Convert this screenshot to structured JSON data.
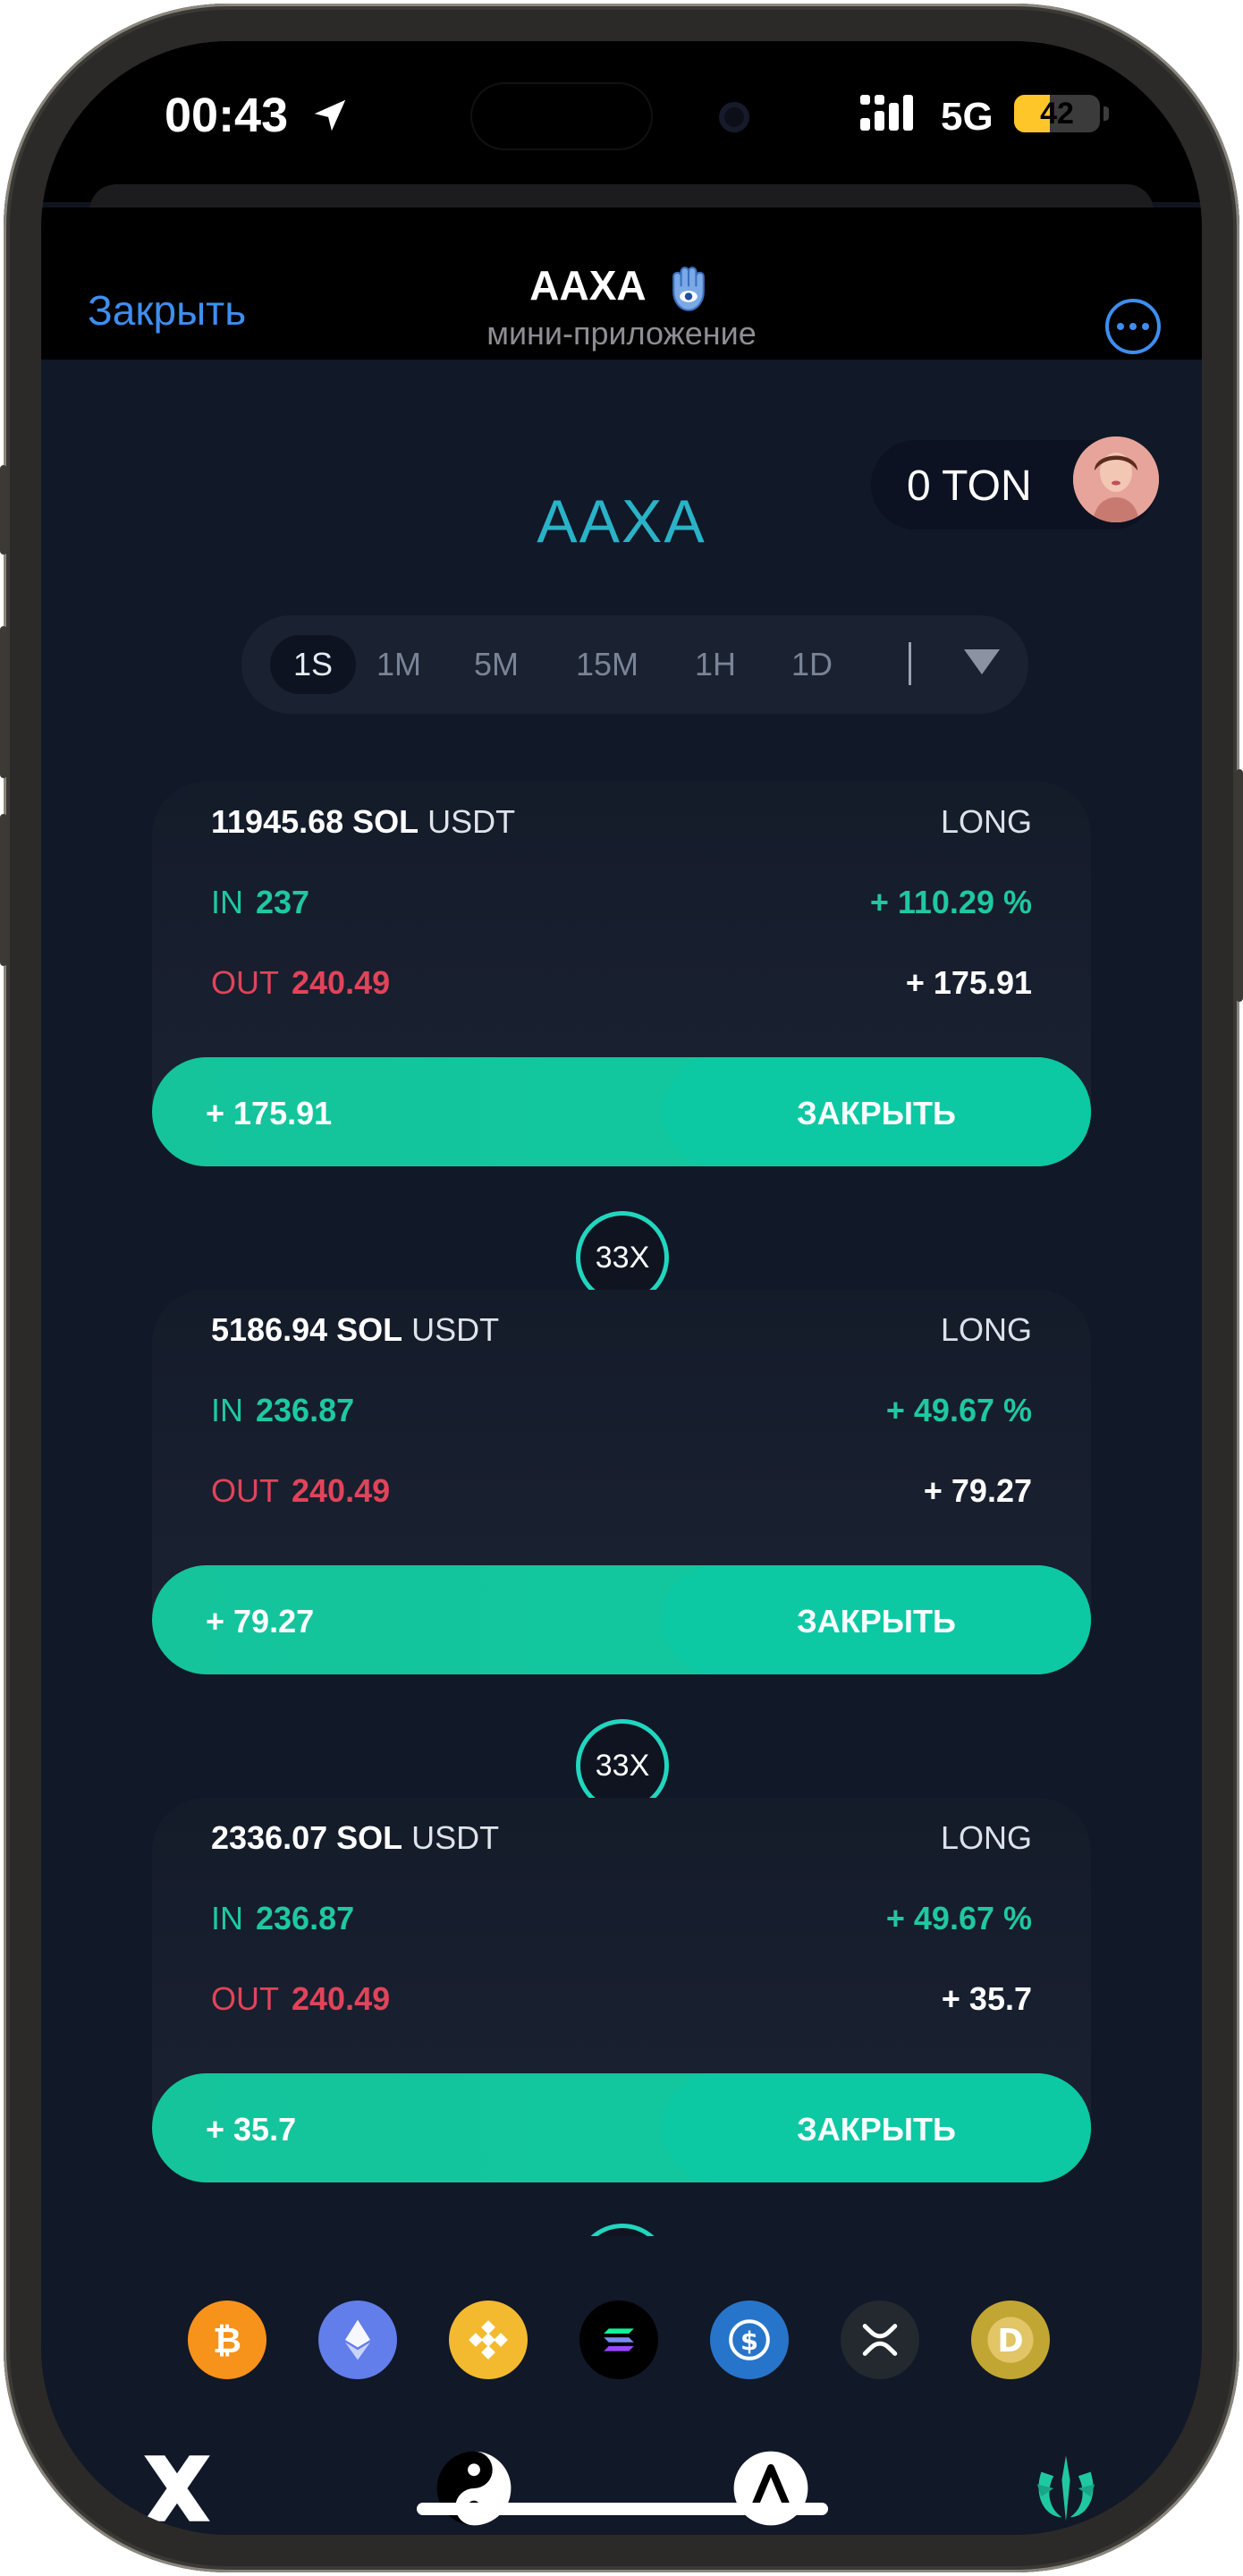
{
  "status": {
    "time": "00:43",
    "network": "5G",
    "battery": "42",
    "battery_percent": 42
  },
  "telegram": {
    "close_label": "Закрыть",
    "app_title": "AAXA",
    "app_subtitle": "мини-приложение"
  },
  "app": {
    "brand": "AAXA",
    "balance": "0 TON",
    "timeframes": [
      "1S",
      "1M",
      "5M",
      "15M",
      "1H",
      "1D"
    ],
    "active_timeframe": "1S"
  },
  "positions": [
    {
      "amount": "11945.68 SOL",
      "quote": "USDT",
      "side": "LONG",
      "in_label": "IN",
      "in_value": "237",
      "pct": "+ 110.29 %",
      "out_label": "OUT",
      "out_value": "240.49",
      "pnl": "+ 175.91",
      "bar_value": "+ 175.91",
      "close_label": "ЗАКРЫТЬ",
      "leverage": "33X"
    },
    {
      "amount": "5186.94 SOL",
      "quote": "USDT",
      "side": "LONG",
      "in_label": "IN",
      "in_value": "236.87",
      "pct": "+ 49.67 %",
      "out_label": "OUT",
      "out_value": "240.49",
      "pnl": "+ 79.27",
      "bar_value": "+ 79.27",
      "close_label": "ЗАКРЫТЬ",
      "leverage": "33X"
    },
    {
      "amount": "2336.07 SOL",
      "quote": "USDT",
      "side": "LONG",
      "in_label": "IN",
      "in_value": "236.87",
      "pct": "+ 49.67 %",
      "out_label": "OUT",
      "out_value": "240.49",
      "pnl": "+ 35.7",
      "bar_value": "+ 35.7",
      "close_label": "ЗАКРЫТЬ"
    }
  ],
  "coins": [
    "bitcoin-icon",
    "ethereum-icon",
    "bnb-icon",
    "solana-icon",
    "usdc-icon",
    "xrp-icon",
    "dogecoin-icon"
  ],
  "colors": {
    "accent": "#1fc8a2",
    "danger": "#e0445a",
    "brand": "#2ab3c8",
    "link": "#3e8ef0",
    "background": "#111827"
  }
}
